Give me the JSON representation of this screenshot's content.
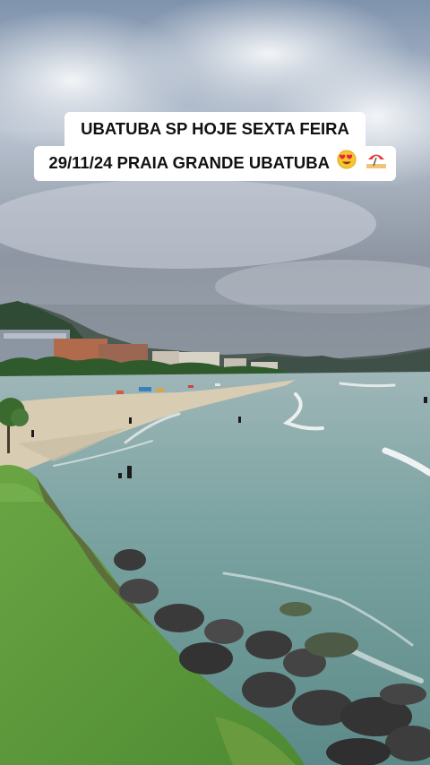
{
  "caption": {
    "line1": "UBATUBA SP HOJE SEXTA FEIRA",
    "line2": "29/11/24 PRAIA GRANDE UBATUBA"
  },
  "emojis": [
    "heart-eyes-face-icon",
    "beach-umbrella-icon"
  ],
  "colors": {
    "sky": "#a9b3c2",
    "sea": "#6f9a98",
    "sand": "#d9cdb5",
    "grass": "#5f9a3c",
    "caption_bg": "#ffffff"
  }
}
